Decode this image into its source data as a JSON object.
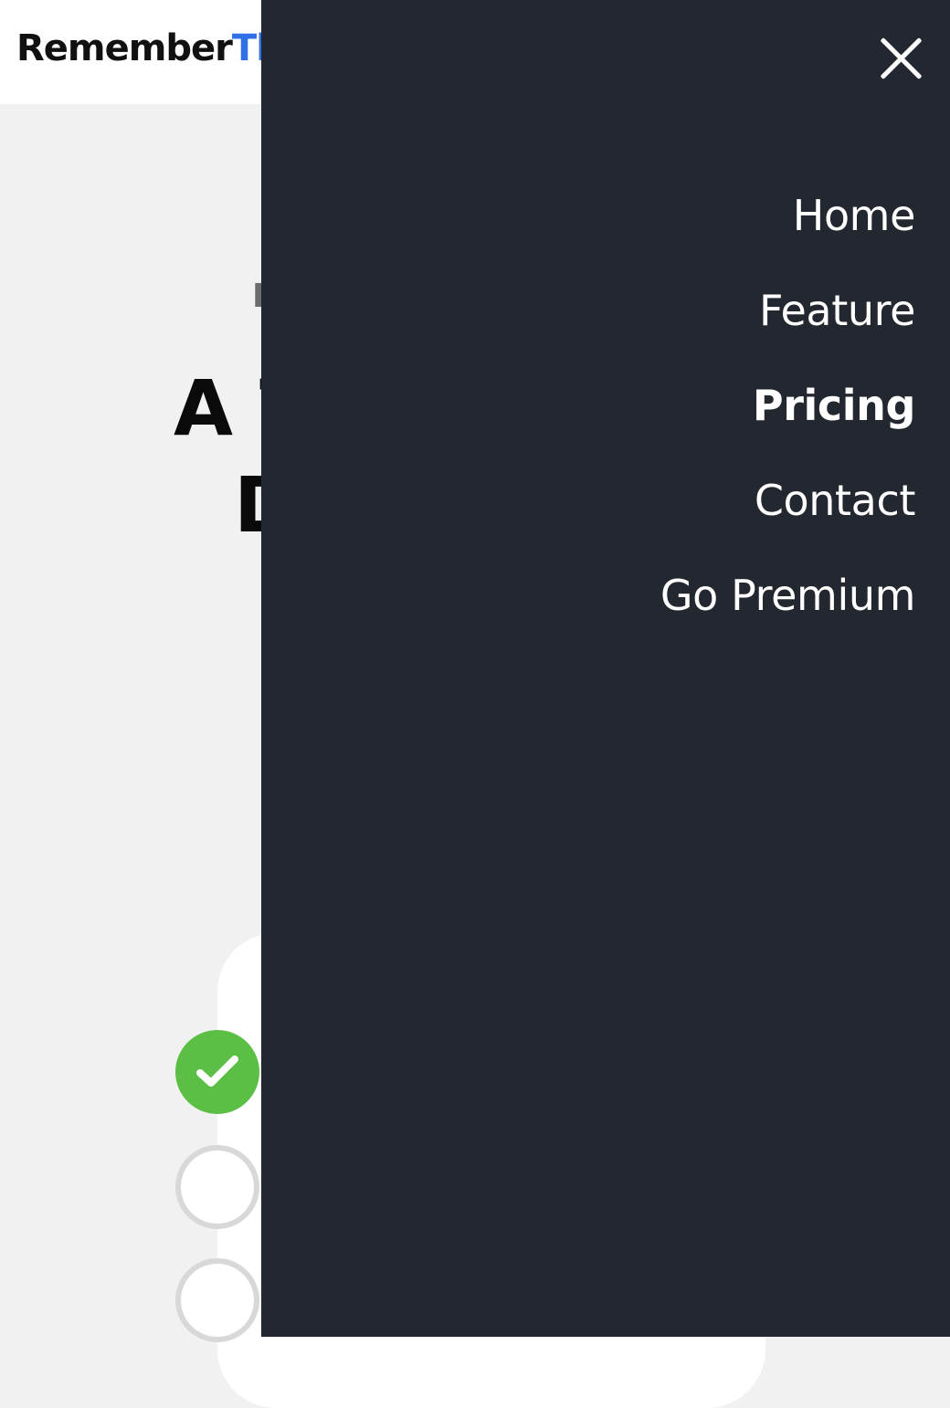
{
  "header": {
    "logo_primary": "Remember",
    "logo_secondary": "Th"
  },
  "hero": {
    "subtitle": "I",
    "headline_line1": "A T",
    "headline_line2": "D"
  },
  "menu": {
    "items": [
      {
        "label": "Home"
      },
      {
        "label": "Feature"
      },
      {
        "label": "Pricing",
        "active": true
      },
      {
        "label": "Contact"
      },
      {
        "label": "Go Premium"
      }
    ]
  },
  "icons": {
    "close": "close-icon",
    "completed_task": "check-icon"
  },
  "colors": {
    "drawer": "#23272f",
    "brand_blue": "#2f6fe7",
    "complete_green": "#5bbf45"
  }
}
